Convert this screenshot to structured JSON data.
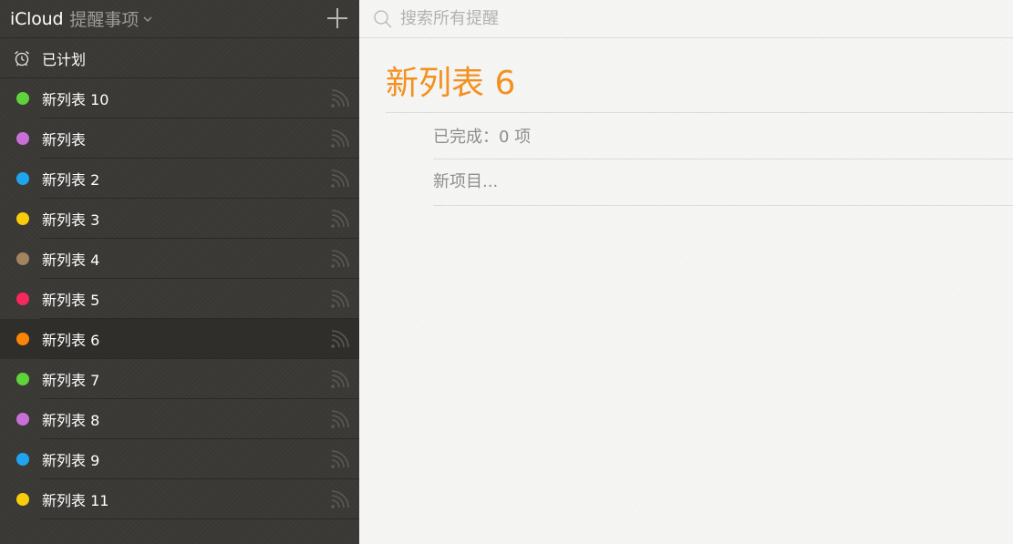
{
  "sidebar": {
    "brand": "iCloud",
    "app_name": "提醒事项",
    "chevron_glyph": "⌄",
    "scheduled_label": "已计划",
    "items": [
      {
        "label": "新列表 10",
        "color": "#5fd33a",
        "selected": false
      },
      {
        "label": "新列表",
        "color": "#c96fd8",
        "selected": false
      },
      {
        "label": "新列表 2",
        "color": "#1fa5ef",
        "selected": false
      },
      {
        "label": "新列表 3",
        "color": "#f9cc0c",
        "selected": false
      },
      {
        "label": "新列表 4",
        "color": "#a2845e",
        "selected": false
      },
      {
        "label": "新列表 5",
        "color": "#f7285e",
        "selected": false
      },
      {
        "label": "新列表 6",
        "color": "#fb8506",
        "selected": true
      },
      {
        "label": "新列表 7",
        "color": "#5fd33a",
        "selected": false
      },
      {
        "label": "新列表 8",
        "color": "#c96fd8",
        "selected": false
      },
      {
        "label": "新列表 9",
        "color": "#1fa5ef",
        "selected": false
      },
      {
        "label": "新列表 11",
        "color": "#f9cc0c",
        "selected": false
      }
    ]
  },
  "search": {
    "placeholder": "搜索所有提醒"
  },
  "main": {
    "title": "新列表 6",
    "title_color": "#f3901f",
    "completed_label": "已完成：0 项",
    "new_item_placeholder": "新项目..."
  }
}
